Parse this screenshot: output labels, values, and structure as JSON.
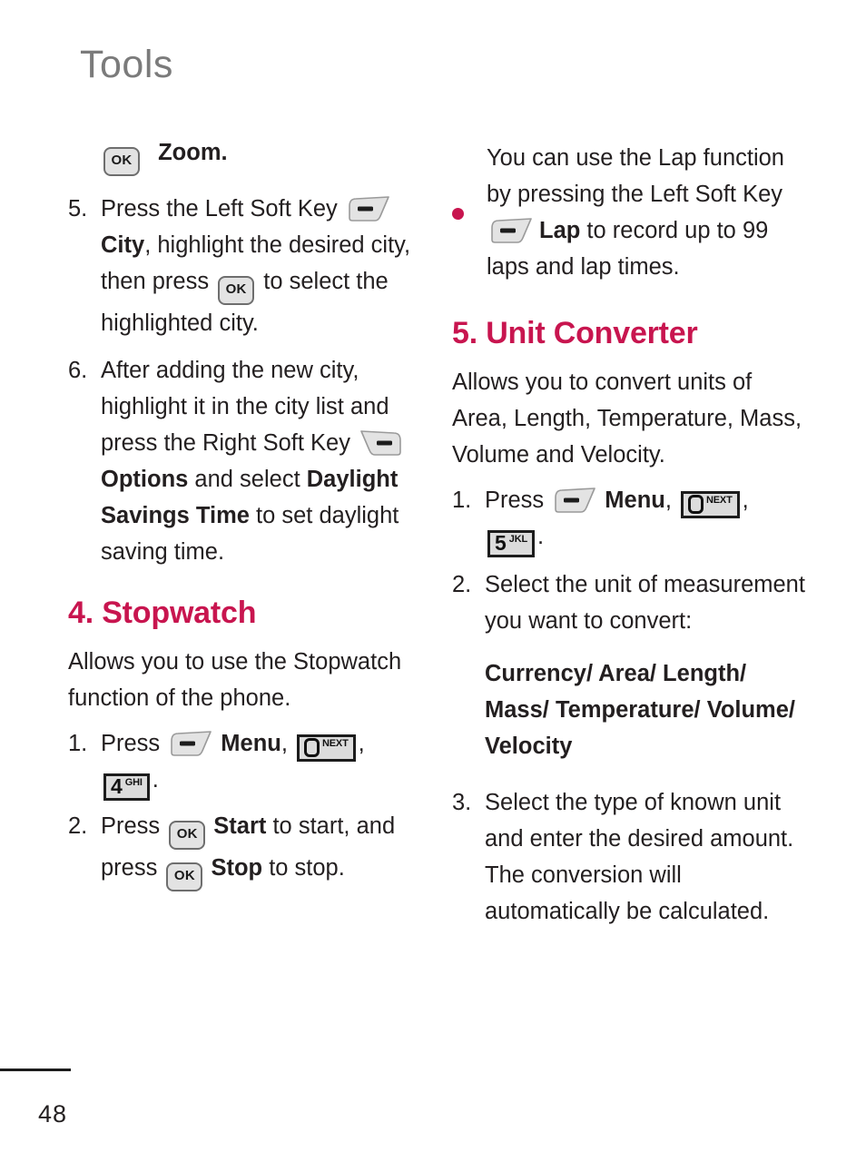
{
  "header": {
    "title": "Tools"
  },
  "footer": {
    "page_number": "48"
  },
  "colors": {
    "accent": "#c8154f",
    "header_gray": "#7b7b7b",
    "body_text": "#231f20",
    "key_fill": "#e3e3e3",
    "key_border": "#6e6e6e",
    "numkey_border": "#1c1c1c"
  },
  "keys": {
    "ok_label": "OK",
    "zero": {
      "digit": "0",
      "sub": "NEXT"
    },
    "four": {
      "digit": "4",
      "sub": "GHI"
    },
    "five": {
      "digit": "5",
      "sub": "JKL"
    }
  },
  "left_column": {
    "zoom_line": {
      "label": "Zoom."
    },
    "step5": {
      "num": "5.",
      "t1": "Press the Left Soft Key ",
      "t2": "City",
      "t3": ", highlight the desired city, then press ",
      "t4": " to select the highlighted city."
    },
    "step6": {
      "num": "6.",
      "t1": "After adding the new city, highlight it in the city list and press the Right Soft Key",
      "t2": "Options",
      "t3": " and select ",
      "t4": "Daylight Savings Time",
      "t5": " to set daylight saving time."
    },
    "stopwatch": {
      "heading": "4. Stopwatch",
      "intro": "Allows you to use the Stopwatch function of the phone.",
      "step1": {
        "num": "1.",
        "t1": "Press ",
        "t2": "Menu",
        "t3": ",",
        "t4": ",",
        "t5": "."
      },
      "step2": {
        "num": "2.",
        "t1": "Press ",
        "t2": "Start",
        "t3": " to start, and press ",
        "t4": "Stop",
        "t5": " to stop."
      }
    }
  },
  "right_column": {
    "lap_bullet": {
      "t1": "You can use the Lap function by pressing the Left Soft Key ",
      "t2": "Lap",
      "t3": " to record up to 99 laps and lap times."
    },
    "unit_converter": {
      "heading": "5. Unit Converter",
      "intro": "Allows you to convert units of Area, Length, Temperature, Mass, Volume and Velocity.",
      "step1": {
        "num": "1.",
        "t1": "Press ",
        "t2": "Menu",
        "t3": ",",
        "t4": ",",
        "t5": "."
      },
      "step2": {
        "num": "2.",
        "t1": "Select the unit of measurement you want to convert:",
        "units": "Currency/ Area/ Length/ Mass/ Temperature/ Volume/ Velocity"
      },
      "step3": {
        "num": "3.",
        "t1": "Select the type of known unit and enter the desired amount. The conversion will automatically be calculated."
      }
    }
  }
}
